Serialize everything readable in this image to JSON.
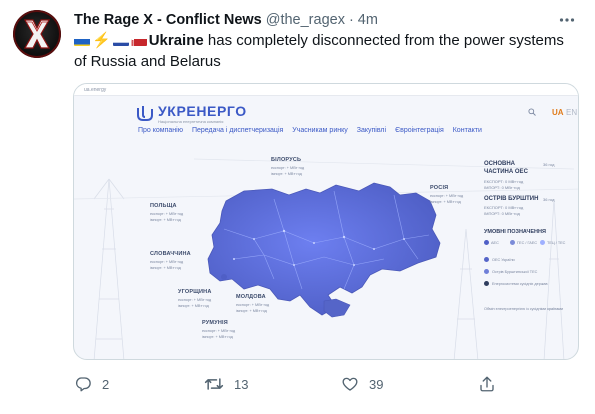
{
  "tweet": {
    "author": {
      "display_name": "The Rage X - Conflict News",
      "handle": "@the_ragex",
      "separator": "·",
      "time": "4m"
    },
    "text": {
      "bold": "Ukraine",
      "rest": " has completely disconnected from the power systems of Russia and Belarus"
    },
    "actions": {
      "replies": "2",
      "retweets": "13",
      "likes": "39"
    }
  },
  "media": {
    "url": "ua.energy",
    "logo": "УКРЕНЕРГО",
    "logo_subtitle": "Національна енергетична компанія",
    "lang_active": "UA",
    "lang_other": "EN",
    "nav": [
      "Про компанію",
      "Передача і диспетчеризація",
      "Учасникам ринку",
      "Закупівлі",
      "Євроінтеграція",
      "Контакти"
    ],
    "regions": [
      {
        "name": "БІЛОРУСЬ",
        "line1": "експорт: + МВт·год",
        "line2": "імпорт: + МВт·год"
      },
      {
        "name": "РОСІЯ",
        "line1": "експорт: + МВт·год",
        "line2": "імпорт: + МВт·год"
      },
      {
        "name": "ПОЛЬЩА",
        "line1": "експорт: + МВт·год",
        "line2": "імпорт: + МВт·год"
      },
      {
        "name": "СЛОВАЧЧИНА",
        "line1": "експорт: + МВт·год",
        "line2": "імпорт: + МВт·год"
      },
      {
        "name": "УГОРЩИНА",
        "line1": "експорт: + МВт·год",
        "line2": "імпорт: + МВт·год"
      },
      {
        "name": "МОЛДОВА",
        "line1": "експорт: + МВт·год",
        "line2": "імпорт: + МВт·год"
      },
      {
        "name": "РУМУНІЯ",
        "line1": "експорт: + МВт·год",
        "line2": "імпорт: + МВт·год"
      }
    ],
    "side": {
      "oes_title_1": "ОСНОВНА",
      "oes_title_2": "ЧАСТИНА ОЕС",
      "oes_value": "36 год",
      "oes_export": "ЕКСПОРТ: 0 МВт·год",
      "oes_import": "ІМПОРТ: 0 МВт·год",
      "burshtyn_title": "ОСТРІВ БУРШТИН",
      "burshtyn_value": "36 год",
      "burshtyn_export": "ЕКСПОРТ: 0 МВт·год",
      "burshtyn_import": "ІМПОРТ: 0 МВт·год",
      "legend_title": "УМОВНІ ПОЗНАЧЕННЯ",
      "legend_top": [
        "АЕС",
        "ГЕС / ГАЕС",
        "ТЕЦ / ТЕС"
      ],
      "legend_items": [
        "ОЕС України",
        "Острів Бурштинської ТЕС",
        "Енергосистеми сусідніх держав"
      ],
      "note": "Обмін електроенергією із сусідніми країнами"
    },
    "colors": {
      "map": "#5566cc",
      "brand": "#3b59c6",
      "accent": "#e07b1a"
    }
  }
}
